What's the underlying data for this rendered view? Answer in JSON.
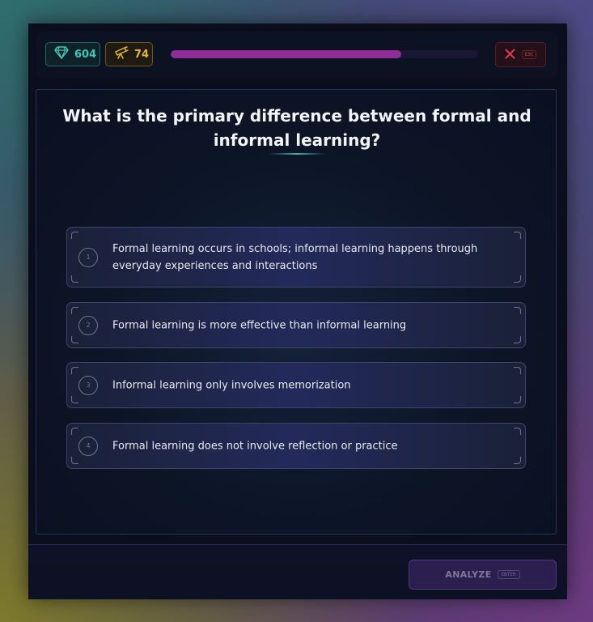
{
  "topbar": {
    "gems": {
      "icon": "diamond-icon",
      "value": "604",
      "color": "#39c8b9"
    },
    "scope": {
      "icon": "telescope-icon",
      "value": "74",
      "color": "#e3b72c"
    },
    "progress": {
      "fraction": 0.75,
      "color": "#8e2d95"
    },
    "close": {
      "icon": "close-icon",
      "key_hint": "ESC",
      "color": "#e23a4e"
    }
  },
  "question": {
    "text": "What is the primary difference between formal and informal learning?"
  },
  "options": [
    {
      "number": "1",
      "text": "Formal learning occurs in schools; informal learning happens through everyday experiences and interactions"
    },
    {
      "number": "2",
      "text": "Formal learning is more effective than informal learning"
    },
    {
      "number": "3",
      "text": "Informal learning only involves memorization"
    },
    {
      "number": "4",
      "text": "Formal learning does not involve reflection or practice"
    }
  ],
  "footer": {
    "analyze_label": "ANALYZE",
    "analyze_key_hint": "ENTER"
  }
}
